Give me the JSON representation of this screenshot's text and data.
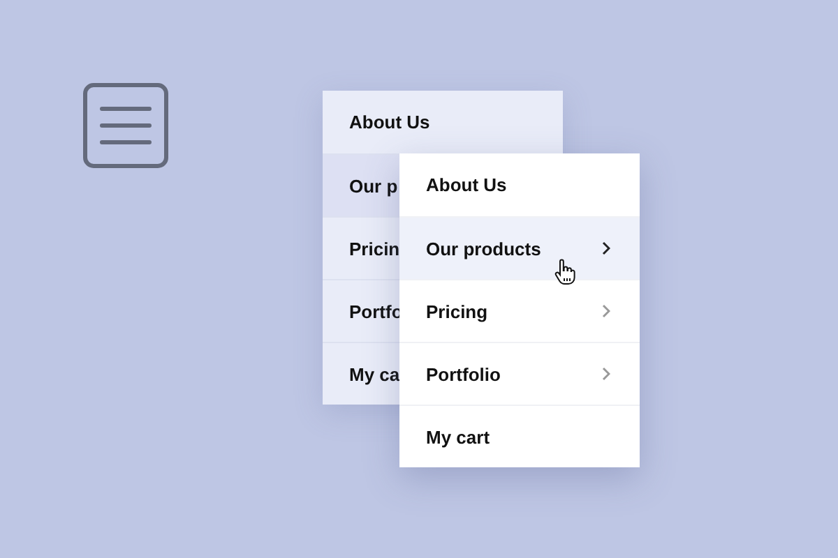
{
  "back_menu": {
    "items": [
      {
        "label": "About Us",
        "selected": false
      },
      {
        "label": "Our p",
        "selected": true
      },
      {
        "label": "Pricin",
        "selected": false
      },
      {
        "label": "Portfo",
        "selected": false
      },
      {
        "label": "My ca",
        "selected": false
      }
    ]
  },
  "front_menu": {
    "items": [
      {
        "label": "About Us",
        "selected": false,
        "submenu": false
      },
      {
        "label": "Our products",
        "selected": true,
        "submenu": true
      },
      {
        "label": "Pricing",
        "selected": false,
        "submenu": true
      },
      {
        "label": "Portfolio",
        "selected": false,
        "submenu": true
      },
      {
        "label": "My cart",
        "selected": false,
        "submenu": false
      }
    ]
  }
}
